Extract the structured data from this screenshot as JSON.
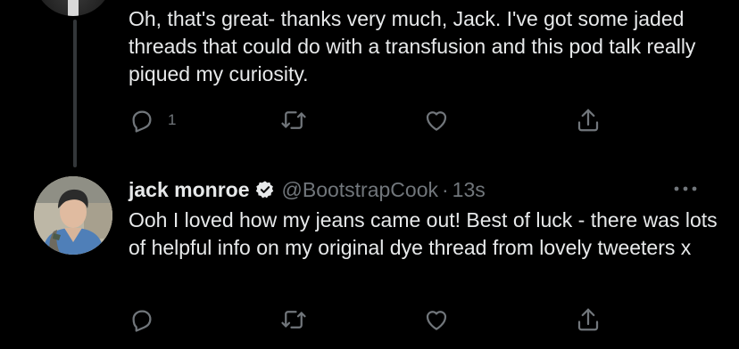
{
  "thread": {
    "previous_tweet": {
      "text": "Oh, that's great- thanks very much, Jack. I've got some jaded threads that could do with a transfusion and this pod talk really piqued my curiosity.",
      "actions": {
        "reply_count": "1",
        "retweet_icon": "retweet-icon",
        "like_icon": "heart-icon",
        "share_icon": "share-icon"
      }
    },
    "reply_tweet": {
      "display_name": "jack monroe",
      "verified_icon": "verified-badge-icon",
      "handle": "@BootstrapCook",
      "separator": "·",
      "timestamp": "13s",
      "text": "Ooh I loved how my jeans came out! Best of luck - there was lots of helpful info on my original dye thread from lovely tweeters x",
      "more_icon": "more-options-icon"
    }
  },
  "colors": {
    "background": "#000000",
    "primary_text": "#e7e9ea",
    "secondary_text": "#71767b",
    "thread_line": "#333639"
  }
}
